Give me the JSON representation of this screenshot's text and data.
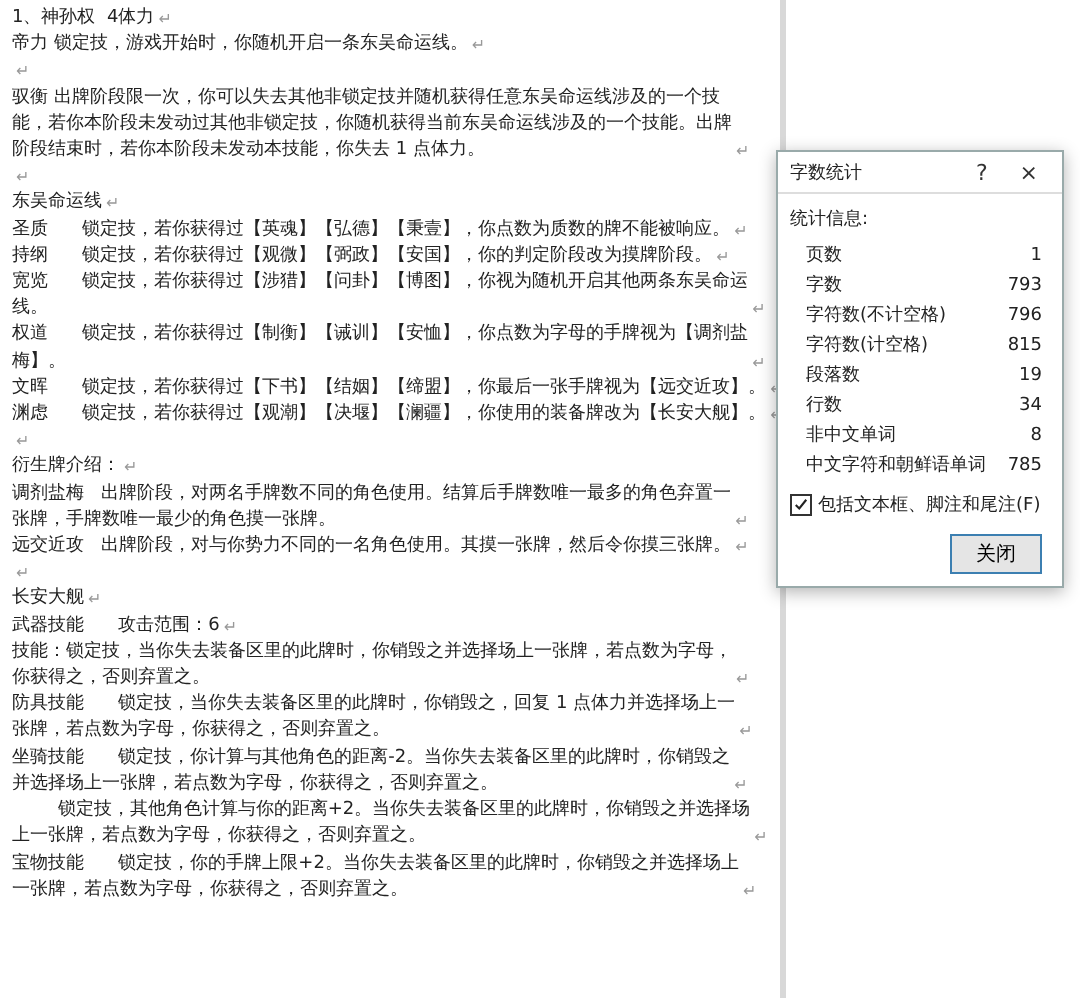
{
  "document": {
    "paragraph_mark": "↵",
    "paragraphs": [
      {
        "kind": "text",
        "lines": [
          "1、神孙权  4体力"
        ]
      },
      {
        "kind": "text",
        "lines": [
          "帝力 锁定技，游戏开始时，你随机开启一条东吴命运线。"
        ]
      },
      {
        "kind": "empty"
      },
      {
        "kind": "text",
        "lines": [
          "驭衡 出牌阶段限一次，你可以失去其他非锁定技并随机获得任意东吴命运线涉及的一个技",
          "能，若你本阶段未发动过其他非锁定技，你随机获得当前东吴命运线涉及的一个技能。出牌",
          "阶段结束时，若你本阶段未发动本技能，你失去 1 点体力。"
        ]
      },
      {
        "kind": "empty"
      },
      {
        "kind": "text",
        "lines": [
          "东吴命运线"
        ]
      },
      {
        "kind": "text",
        "lines": [
          "圣质      锁定技，若你获得过【英魂】【弘德】【秉壹】，你点数为质数的牌不能被响应。"
        ]
      },
      {
        "kind": "text",
        "lines": [
          "持纲      锁定技，若你获得过【观微】【弼政】【安国】，你的判定阶段改为摸牌阶段。"
        ]
      },
      {
        "kind": "text",
        "lines": [
          "宽览      锁定技，若你获得过【涉猎】【问卦】【博图】，你视为随机开启其他两条东吴命运",
          "线。"
        ]
      },
      {
        "kind": "text",
        "lines": [
          "权道      锁定技，若你获得过【制衡】【诫训】【安恤】，你点数为字母的手牌视为【调剂盐",
          "梅】。"
        ]
      },
      {
        "kind": "text",
        "lines": [
          "文晖      锁定技，若你获得过【下书】【结姻】【缔盟】，你最后一张手牌视为【远交近攻】。"
        ]
      },
      {
        "kind": "text",
        "lines": [
          "渊虑      锁定技，若你获得过【观潮】【决堰】【澜疆】，你使用的装备牌改为【长安大舰】。"
        ]
      },
      {
        "kind": "empty"
      },
      {
        "kind": "text",
        "lines": [
          "衍生牌介绍："
        ]
      },
      {
        "kind": "text",
        "lines": [
          "调剂盐梅   出牌阶段，对两名手牌数不同的角色使用。结算后手牌数唯一最多的角色弃置一",
          "张牌，手牌数唯一最少的角色摸一张牌。"
        ]
      },
      {
        "kind": "text",
        "lines": [
          "远交近攻   出牌阶段，对与你势力不同的一名角色使用。其摸一张牌，然后令你摸三张牌。"
        ]
      },
      {
        "kind": "empty"
      },
      {
        "kind": "text",
        "lines": [
          "长安大舰"
        ]
      },
      {
        "kind": "text",
        "lines": [
          "武器技能      攻击范围：6"
        ]
      },
      {
        "kind": "text",
        "lines": [
          "技能：锁定技，当你失去装备区里的此牌时，你销毁之并选择场上一张牌，若点数为字母，",
          "你获得之，否则弃置之。"
        ]
      },
      {
        "kind": "text",
        "lines": [
          "防具技能      锁定技，当你失去装备区里的此牌时，你销毁之，回复 1 点体力并选择场上一",
          "张牌，若点数为字母，你获得之，否则弃置之。"
        ]
      },
      {
        "kind": "text",
        "lines": [
          "坐骑技能      锁定技，你计算与其他角色的距离-2。当你失去装备区里的此牌时，你销毁之",
          "并选择场上一张牌，若点数为字母，你获得之，否则弃置之。"
        ]
      },
      {
        "kind": "text",
        "lines": [
          "        锁定技，其他角色计算与你的距离+2。当你失去装备区里的此牌时，你销毁之并选择场",
          "上一张牌，若点数为字母，你获得之，否则弃置之。"
        ]
      },
      {
        "kind": "text",
        "lines": [
          "宝物技能      锁定技，你的手牌上限+2。当你失去装备区里的此牌时，你销毁之并选择场上",
          "一张牌，若点数为字母，你获得之，否则弃置之。"
        ]
      }
    ]
  },
  "dialog": {
    "title": "字数统计",
    "help": "?",
    "close": "×",
    "section": "统计信息:",
    "stats": [
      {
        "label": "页数",
        "value": "1"
      },
      {
        "label": "字数",
        "value": "793"
      },
      {
        "label": "字符数(不计空格)",
        "value": "796"
      },
      {
        "label": "字符数(计空格)",
        "value": "815"
      },
      {
        "label": "段落数",
        "value": "19"
      },
      {
        "label": "行数",
        "value": "34"
      },
      {
        "label": "非中文单词",
        "value": "8"
      },
      {
        "label": "中文字符和朝鲜语单词",
        "value": "785"
      }
    ],
    "checkbox": {
      "label": "包括文本框、脚注和尾注(F)",
      "checked": true
    },
    "button": "关闭"
  }
}
